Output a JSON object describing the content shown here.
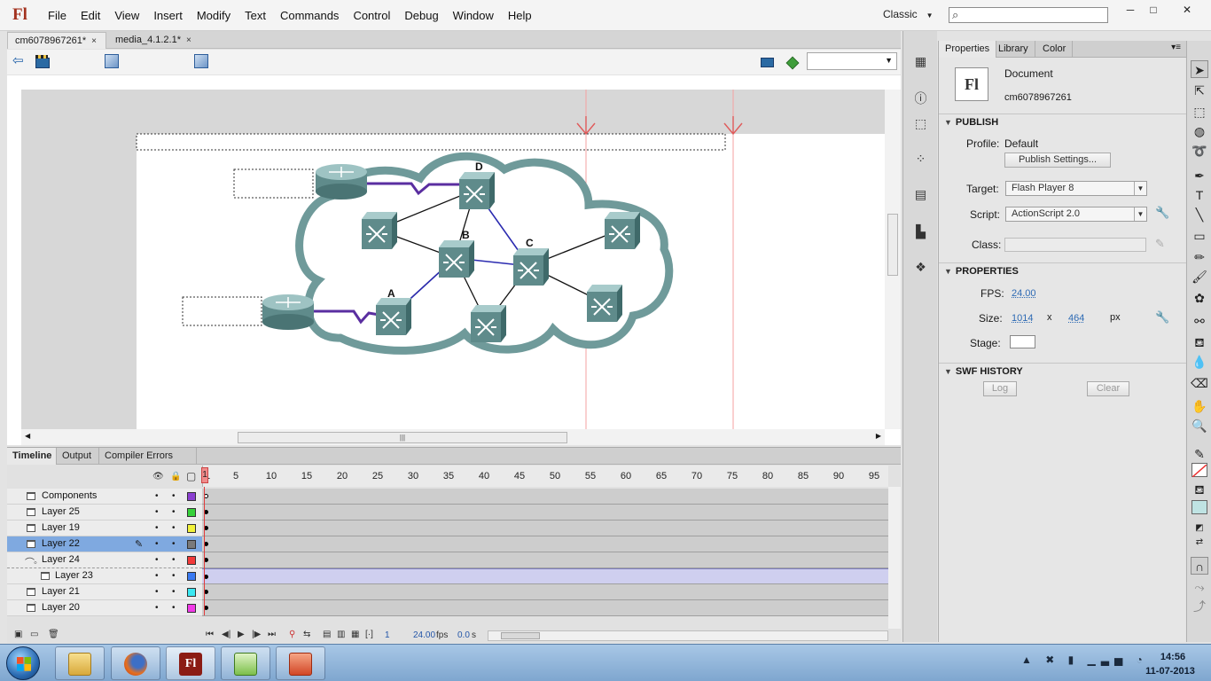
{
  "app": {
    "logo": "Fl",
    "menu": [
      "File",
      "Edit",
      "View",
      "Insert",
      "Modify",
      "Text",
      "Commands",
      "Control",
      "Debug",
      "Window",
      "Help"
    ],
    "workspace": "Classic",
    "search_placeholder": "",
    "window_controls": [
      "─",
      "□",
      "✕"
    ]
  },
  "doc_tabs": [
    {
      "label": "cm6078967261*",
      "close": "×"
    },
    {
      "label": "media_4.1.2.1*",
      "close": "×"
    }
  ],
  "diagram": {
    "node_labels": {
      "a": "A",
      "b": "B",
      "c": "C",
      "d": "D"
    }
  },
  "timeline": {
    "tabs": [
      "Timeline",
      "Output",
      "Compiler Errors"
    ],
    "ruler": [
      "1",
      "5",
      "10",
      "15",
      "20",
      "25",
      "30",
      "35",
      "40",
      "45",
      "50",
      "55",
      "60",
      "65",
      "70",
      "75",
      "80",
      "85",
      "90",
      "95"
    ],
    "layers": [
      {
        "name": "Components",
        "color": "#8b3fd1"
      },
      {
        "name": "Layer 25",
        "color": "#36d13a"
      },
      {
        "name": "Layer 19",
        "color": "#f2f23a"
      },
      {
        "name": "Layer 22",
        "color": "#7a7a7a",
        "selected": true
      },
      {
        "name": "Layer 24",
        "color": "#f23a3a",
        "guide": true
      },
      {
        "name": "Layer 23",
        "color": "#3a7af2",
        "guided": true
      },
      {
        "name": "Layer 21",
        "color": "#3ae8f2"
      },
      {
        "name": "Layer 20",
        "color": "#f23ae8"
      }
    ],
    "footer": {
      "frame": "1",
      "fps": "24.00",
      "fps_unit": "fps",
      "time": "0.0",
      "time_unit": "s"
    }
  },
  "properties": {
    "tabs": [
      "Properties",
      "Library",
      "Color"
    ],
    "doc_type": "Document",
    "doc_name": "cm6078967261",
    "thumb": "Fl",
    "publish": {
      "header": "PUBLISH",
      "profile_label": "Profile:",
      "profile_value": "Default",
      "settings_button": "Publish Settings...",
      "target_label": "Target:",
      "target_value": "Flash Player 8",
      "script_label": "Script:",
      "script_value": "ActionScript 2.0",
      "class_label": "Class:"
    },
    "props": {
      "header": "PROPERTIES",
      "fps_label": "FPS:",
      "fps_value": "24.00",
      "size_label": "Size:",
      "width": "1014",
      "x": "x",
      "height": "464",
      "unit": "px",
      "stage_label": "Stage:",
      "stage_color": "#ffffff"
    },
    "swf_history": {
      "header": "SWF HISTORY",
      "log_button": "Log",
      "clear_button": "Clear"
    }
  },
  "taskbar": {
    "tray_icons": "▲ ✖ ▮ ▁▃▅ ◔",
    "time": "14:56",
    "date": "11-07-2013"
  }
}
